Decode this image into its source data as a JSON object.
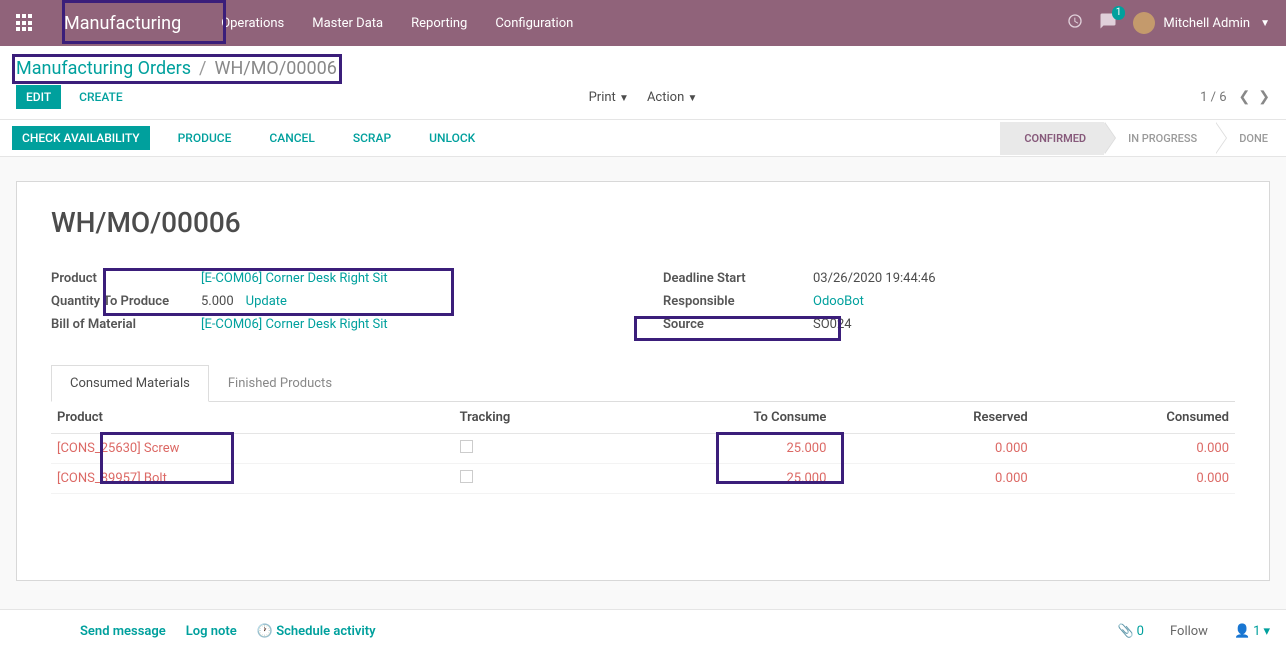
{
  "nav": {
    "brand": "Manufacturing",
    "menu": [
      "Operations",
      "Master Data",
      "Reporting",
      "Configuration"
    ],
    "chat_badge": "1",
    "user": "Mitchell Admin"
  },
  "crumbs": {
    "parent": "Manufacturing Orders",
    "sep": "/",
    "current": "WH/MO/00006"
  },
  "actions": {
    "edit": "EDIT",
    "create": "CREATE",
    "print": "Print",
    "action": "Action",
    "pager": "1 / 6"
  },
  "statusbar": {
    "check": "CHECK AVAILABILITY",
    "produce": "PRODUCE",
    "cancel": "CANCEL",
    "scrap": "SCRAP",
    "unlock": "UNLOCK",
    "steps": [
      "CONFIRMED",
      "IN PROGRESS",
      "DONE"
    ]
  },
  "record": {
    "title": "WH/MO/00006",
    "labels": {
      "product": "Product",
      "qty": "Quantity To Produce",
      "bom": "Bill of Material",
      "deadline": "Deadline Start",
      "responsible": "Responsible",
      "source": "Source"
    },
    "product": "[E-COM06] Corner Desk Right Sit",
    "qty": "5.000",
    "qty_update": "Update",
    "bom": "[E-COM06] Corner Desk Right Sit",
    "deadline": "03/26/2020 19:44:46",
    "responsible": "OdooBot",
    "source": "SO024"
  },
  "tabs": {
    "consumed": "Consumed Materials",
    "finished": "Finished Products"
  },
  "table": {
    "cols": {
      "product": "Product",
      "tracking": "Tracking",
      "toconsume": "To Consume",
      "reserved": "Reserved",
      "consumed": "Consumed"
    },
    "rows": [
      {
        "product": "[CONS_25630] Screw",
        "toconsume": "25.000",
        "reserved": "0.000",
        "consumed": "0.000"
      },
      {
        "product": "[CONS_89957] Bolt",
        "toconsume": "25.000",
        "reserved": "0.000",
        "consumed": "0.000"
      }
    ]
  },
  "footer": {
    "send": "Send message",
    "log": "Log note",
    "schedule": "Schedule activity",
    "attach": "0",
    "follow": "Follow",
    "followers": "1"
  }
}
